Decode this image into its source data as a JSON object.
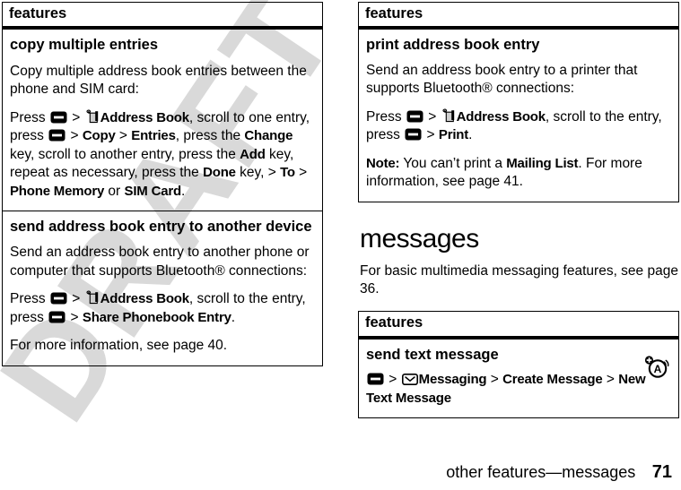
{
  "document": {
    "watermark": "DRAFT",
    "footer": {
      "section": "other features—messages",
      "page_number": "71"
    }
  },
  "left_column": {
    "tables": [
      {
        "header": "features",
        "rows": [
          {
            "title": "copy multiple entries",
            "paragraphs": [
              {
                "id": "p1",
                "parts": [
                  {
                    "t": "text",
                    "v": "Copy multiple address book entries between the phone and SIM card:"
                  }
                ]
              },
              {
                "id": "p2",
                "parts": [
                  {
                    "t": "text",
                    "v": "Press "
                  },
                  {
                    "t": "icon",
                    "v": "menu-key-icon"
                  },
                  {
                    "t": "text",
                    "v": " > "
                  },
                  {
                    "t": "icon",
                    "v": "address-book-icon"
                  },
                  {
                    "t": "bold",
                    "v": "Address Book"
                  },
                  {
                    "t": "text",
                    "v": ", scroll to one entry, press "
                  },
                  {
                    "t": "icon",
                    "v": "menu-key-icon"
                  },
                  {
                    "t": "text",
                    "v": " > "
                  },
                  {
                    "t": "bold",
                    "v": "Copy"
                  },
                  {
                    "t": "text",
                    "v": " > "
                  },
                  {
                    "t": "bold",
                    "v": "Entries"
                  },
                  {
                    "t": "text",
                    "v": ", press the "
                  },
                  {
                    "t": "bold",
                    "v": "Change"
                  },
                  {
                    "t": "text",
                    "v": " key, scroll to another entry, press the "
                  },
                  {
                    "t": "bold",
                    "v": "Add"
                  },
                  {
                    "t": "text",
                    "v": " key, repeat as necessary, press the "
                  },
                  {
                    "t": "bold",
                    "v": "Done"
                  },
                  {
                    "t": "text",
                    "v": " key, > "
                  },
                  {
                    "t": "bold",
                    "v": "To"
                  },
                  {
                    "t": "text",
                    "v": " > "
                  },
                  {
                    "t": "bold",
                    "v": "Phone Memory"
                  },
                  {
                    "t": "text",
                    "v": " or "
                  },
                  {
                    "t": "bold",
                    "v": "SIM Card"
                  },
                  {
                    "t": "text",
                    "v": "."
                  }
                ]
              }
            ]
          },
          {
            "title": "send address book entry to another device",
            "paragraphs": [
              {
                "id": "p1",
                "parts": [
                  {
                    "t": "text",
                    "v": "Send an address book entry to another phone or computer that supports Bluetooth® connections:"
                  }
                ]
              },
              {
                "id": "p2",
                "parts": [
                  {
                    "t": "text",
                    "v": "Press "
                  },
                  {
                    "t": "icon",
                    "v": "menu-key-icon"
                  },
                  {
                    "t": "text",
                    "v": " > "
                  },
                  {
                    "t": "icon",
                    "v": "address-book-icon"
                  },
                  {
                    "t": "bold",
                    "v": "Address Book"
                  },
                  {
                    "t": "text",
                    "v": ", scroll to the entry, press "
                  },
                  {
                    "t": "icon",
                    "v": "menu-key-icon"
                  },
                  {
                    "t": "text",
                    "v": " > "
                  },
                  {
                    "t": "bold",
                    "v": "Share Phonebook Entry"
                  },
                  {
                    "t": "text",
                    "v": "."
                  }
                ]
              },
              {
                "id": "p3",
                "parts": [
                  {
                    "t": "text",
                    "v": "For more information, see page 40."
                  }
                ]
              }
            ]
          }
        ]
      }
    ]
  },
  "right_column": {
    "tables": [
      {
        "header": "features",
        "rows": [
          {
            "title": "print address book entry",
            "paragraphs": [
              {
                "id": "p1",
                "parts": [
                  {
                    "t": "text",
                    "v": "Send an address book entry to a printer that supports Bluetooth® connections:"
                  }
                ]
              },
              {
                "id": "p2",
                "parts": [
                  {
                    "t": "text",
                    "v": "Press "
                  },
                  {
                    "t": "icon",
                    "v": "menu-key-icon"
                  },
                  {
                    "t": "text",
                    "v": " > "
                  },
                  {
                    "t": "icon",
                    "v": "address-book-icon"
                  },
                  {
                    "t": "bold",
                    "v": "Address Book"
                  },
                  {
                    "t": "text",
                    "v": ", scroll to the entry, press "
                  },
                  {
                    "t": "icon",
                    "v": "menu-key-icon"
                  },
                  {
                    "t": "text",
                    "v": " > "
                  },
                  {
                    "t": "bold",
                    "v": "Print"
                  },
                  {
                    "t": "text",
                    "v": "."
                  }
                ]
              },
              {
                "id": "p3",
                "parts": [
                  {
                    "t": "bold",
                    "v": "Note:"
                  },
                  {
                    "t": "text",
                    "v": " You can’t print a "
                  },
                  {
                    "t": "bold",
                    "v": "Mailing List"
                  },
                  {
                    "t": "text",
                    "v": ". For more information, see page 41."
                  }
                ]
              }
            ]
          }
        ]
      },
      {
        "header": "features",
        "corner_icon": "text-message-alert-icon",
        "rows": [
          {
            "title": "send text message",
            "paragraphs": [
              {
                "id": "p1",
                "parts": [
                  {
                    "t": "icon",
                    "v": "menu-key-icon"
                  },
                  {
                    "t": "text",
                    "v": " > "
                  },
                  {
                    "t": "icon",
                    "v": "envelope-icon"
                  },
                  {
                    "t": "bold",
                    "v": "Messaging"
                  },
                  {
                    "t": "text",
                    "v": " > "
                  },
                  {
                    "t": "bold",
                    "v": "Create Message"
                  },
                  {
                    "t": "text",
                    "v": " > "
                  },
                  {
                    "t": "bold",
                    "v": "New Text Message"
                  }
                ]
              }
            ]
          }
        ]
      }
    ],
    "section": {
      "heading": "messages",
      "intro": "For basic multimedia messaging features, see page 36."
    }
  }
}
